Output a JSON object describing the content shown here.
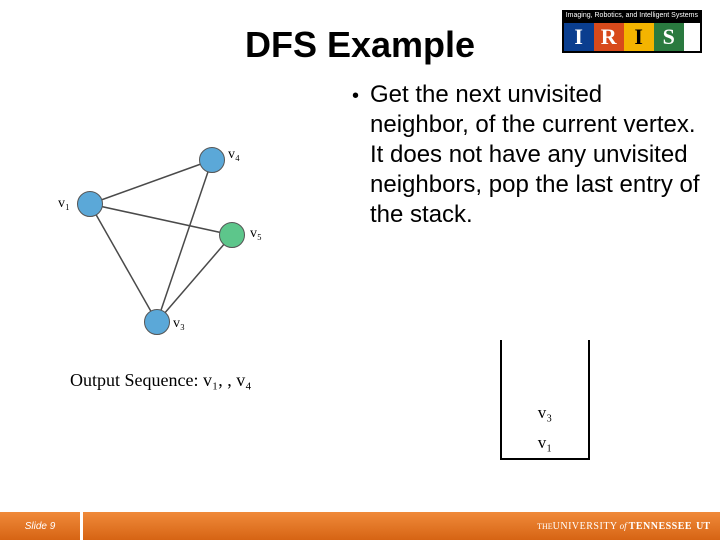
{
  "title": "DFS Example",
  "logo": {
    "tagline": "Imaging, Robotics, and Intelligent Systems",
    "letters": [
      "I",
      "R",
      "I",
      "S"
    ]
  },
  "bullet": {
    "text": "Get the next unvisited neighbor, of the current vertex. It does not have any unvisited neighbors, pop the last entry of the stack."
  },
  "graph": {
    "labels": {
      "v1": "v₁",
      "v3": "v₃",
      "v4": "v₄",
      "v5": "v₅"
    }
  },
  "output": {
    "label": "Output Sequence:",
    "sequence": "v₁, , v₄"
  },
  "stack": {
    "items_top_to_bottom": [
      "v₃",
      "v₁"
    ]
  },
  "footer": {
    "slide": "Slide 9",
    "university_prefix": "THE ",
    "university_mid": "UNIVERSITY",
    "university_of": "of",
    "university_name": "TENNESSEE"
  }
}
